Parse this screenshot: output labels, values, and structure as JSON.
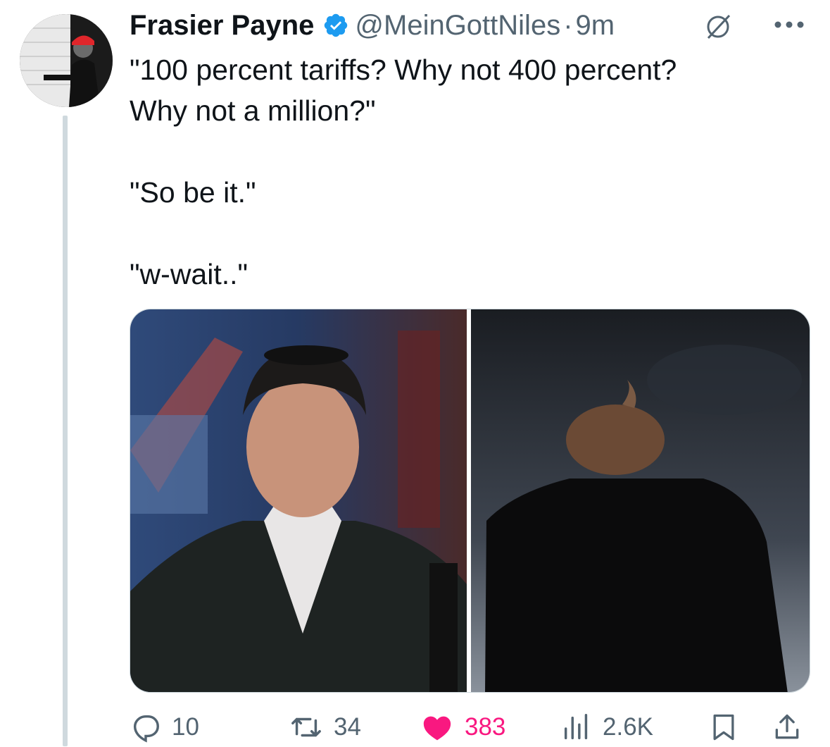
{
  "tweet": {
    "author": {
      "display_name": "Frasier Payne",
      "verified": true,
      "handle": "@MeinGottNiles",
      "separator": "·",
      "time": "9m"
    },
    "text_lines": [
      "\"100 percent tariffs? Why not 400 percent?",
      "Why not a million?\"",
      "",
      "\"So be it.\"",
      "",
      "\"w-wait..\""
    ],
    "media": [
      {
        "icon": "photo-man-in-suit-and-kippah"
      },
      {
        "icon": "photo-man-from-behind-dark-sky"
      }
    ]
  },
  "actions": {
    "replies": "10",
    "reposts": "34",
    "likes": "383",
    "views": "2.6K"
  },
  "colors": {
    "verified": "#1d9bf0",
    "like": "#f91880",
    "secondary_text": "#536471",
    "thread_line": "#cfd9de"
  },
  "icons": [
    "verified-badge-icon",
    "grok-icon",
    "more-icon",
    "reply-icon",
    "repost-icon",
    "like-icon",
    "views-icon",
    "bookmark-icon",
    "share-icon"
  ]
}
